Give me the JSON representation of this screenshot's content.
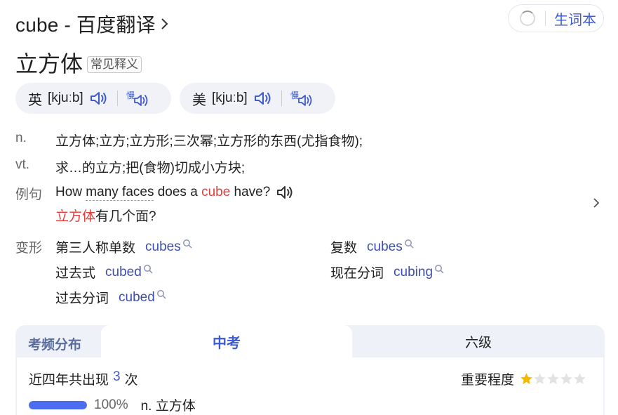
{
  "header": {
    "title": "cube - 百度翻译"
  },
  "vocab": {
    "label": "生词本"
  },
  "word": {
    "text": "立方体",
    "tag": "常见释义"
  },
  "phonetics": [
    {
      "label": "英",
      "ipa": "[kjuːb]"
    },
    {
      "label": "美",
      "ipa": "[kjuːb]"
    }
  ],
  "definitions": [
    {
      "pos": "n.",
      "text": "立方体;立方;立方形;三次幂;立方形的东西(尤指食物);"
    },
    {
      "pos": "vt.",
      "text": "求…的立方;把(食物)切成小方块;"
    }
  ],
  "example": {
    "label": "例句",
    "en_pre": "How ",
    "en_dotted": "many faces",
    "en_mid": " does a ",
    "en_hl": "cube",
    "en_post": " have?",
    "cn_hl": "立方体",
    "cn_rest": "有几个面?"
  },
  "forms": {
    "label": "变形",
    "items": [
      {
        "label": "第三人称单数",
        "word": "cubes"
      },
      {
        "label": "复数",
        "word": "cubes"
      },
      {
        "label": "过去式",
        "word": "cubed"
      },
      {
        "label": "现在分词",
        "word": "cubing"
      },
      {
        "label": "过去分词",
        "word": "cubed"
      }
    ]
  },
  "frequency": {
    "title": "考频分布",
    "tabs": [
      "中考",
      "六级"
    ],
    "count_pre": "近四年共出现",
    "count": "3",
    "count_post": "次",
    "importance_label": "重要程度",
    "importance_stars": 1,
    "importance_max": 5,
    "bar_percent": 100,
    "bar_label": "100%",
    "bar_meaning": "n. 立方体"
  },
  "colors": {
    "accent": "#3d5ad1",
    "highlight": "#e33c3c",
    "star": "#f5b800"
  }
}
